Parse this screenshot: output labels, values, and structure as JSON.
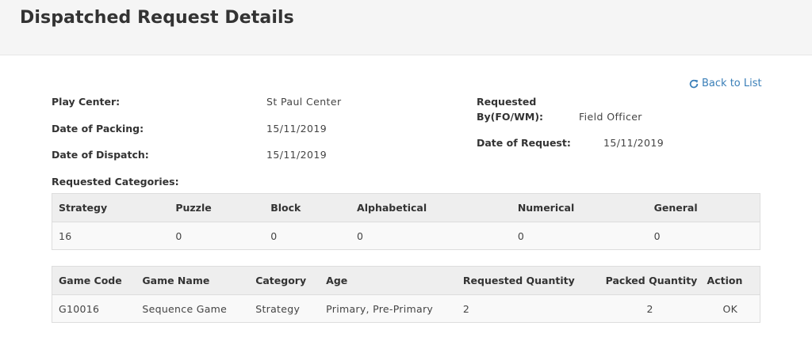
{
  "header": {
    "title": "Dispatched Request Details"
  },
  "back_link": {
    "label": "Back to List",
    "icon": "refresh-icon",
    "color": "#3a7fb8"
  },
  "details": {
    "play_center_label": "Play Center:",
    "play_center_value": "St Paul Center",
    "date_of_packing_label": "Date of Packing:",
    "date_of_packing_value": "15/11/2019",
    "date_of_dispatch_label": "Date of Dispatch:",
    "date_of_dispatch_value": "15/11/2019",
    "requested_by_label_line1": "Requested",
    "requested_by_label_line2": "By(FO/WM):",
    "requested_by_value": "Field Officer",
    "date_of_request_label": "Date of Request:",
    "date_of_request_value": "15/11/2019"
  },
  "categories": {
    "label": "Requested Categories:",
    "headers": [
      "Strategy",
      "Puzzle",
      "Block",
      "Alphabetical",
      "Numerical",
      "General"
    ],
    "row": [
      "16",
      "0",
      "0",
      "0",
      "0",
      "0"
    ]
  },
  "games": {
    "headers": [
      "Game Code",
      "Game Name",
      "Category",
      "Age",
      "Requested Quantity",
      "Packed Quantity",
      "Action"
    ],
    "rows": [
      [
        "G10016",
        "Sequence Game",
        "Strategy",
        "Primary, Pre-Primary",
        "2",
        "2",
        "OK"
      ]
    ]
  }
}
